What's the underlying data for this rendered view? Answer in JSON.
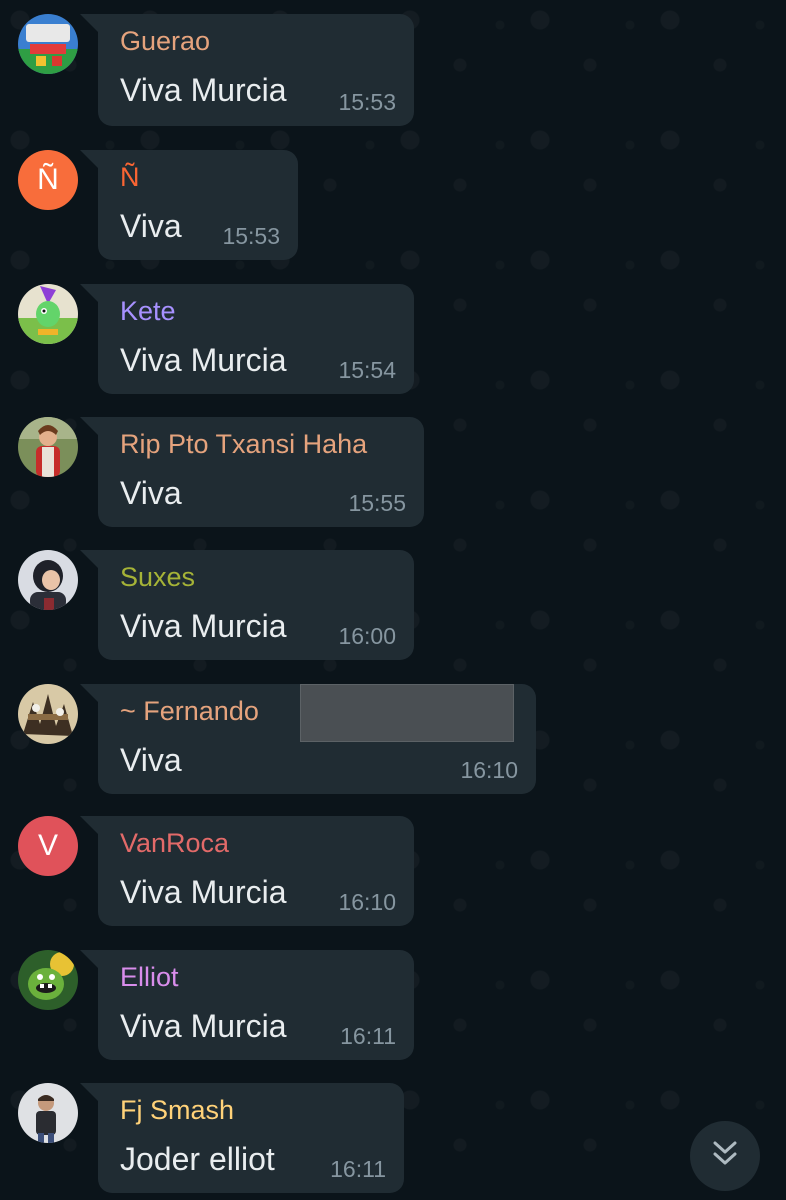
{
  "messages": [
    {
      "sender": "Guerao",
      "text": "Viva Murcia",
      "time": "15:53",
      "sender_color": "#e5a37d"
    },
    {
      "sender": "Ñ",
      "text": "Viva",
      "time": "15:53",
      "sender_color": "#fa6533",
      "avatar_letter": "Ñ",
      "avatar_color": "#f86d3b"
    },
    {
      "sender": "Kete",
      "text": "Viva Murcia",
      "time": "15:54",
      "sender_color": "#a791ff"
    },
    {
      "sender": "Rip Pto Txansi Haha",
      "text": "Viva",
      "time": "15:55",
      "sender_color": "#e5a37d"
    },
    {
      "sender": "Suxes",
      "text": "Viva Murcia",
      "time": "16:00",
      "sender_color": "#a5b337"
    },
    {
      "sender": "~ Fernando",
      "text": "Viva",
      "time": "16:10",
      "sender_color": "#e5a37d"
    },
    {
      "sender": "VanRoca",
      "text": "Viva Murcia",
      "time": "16:10",
      "sender_color": "#e26a69",
      "avatar_letter": "V",
      "avatar_color": "#e0525a"
    },
    {
      "sender": "Elliot",
      "text": "Viva Murcia",
      "time": "16:11",
      "sender_color": "#d88deb"
    },
    {
      "sender": "Fj Smash",
      "text": "Joder elliot",
      "time": "16:11",
      "sender_color": "#ffd279"
    }
  ],
  "scroll_down_icon": "double-chevron-down-icon"
}
